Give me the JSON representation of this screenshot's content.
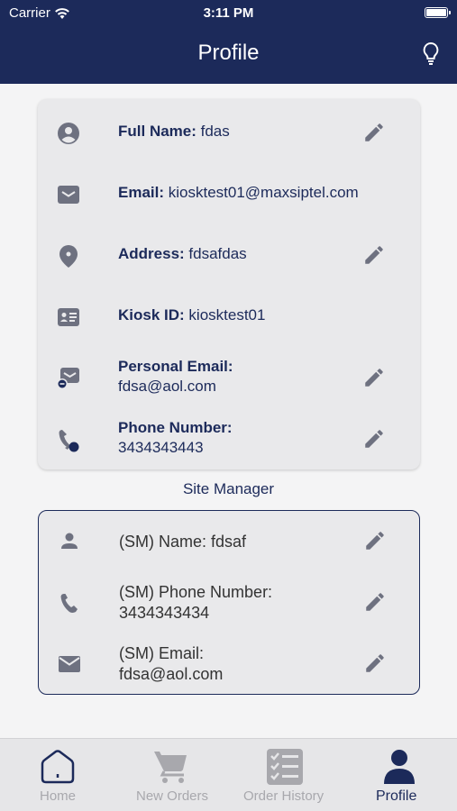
{
  "status_bar": {
    "carrier": "Carrier",
    "time": "3:11 PM"
  },
  "header": {
    "title": "Profile"
  },
  "profile": {
    "full_name": {
      "label": "Full Name:",
      "value": " fdas"
    },
    "email": {
      "label": "Email:",
      "value": " kiosktest01@maxsiptel.com"
    },
    "address": {
      "label": "Address:",
      "value": " fdsafdas"
    },
    "kiosk_id": {
      "label": "Kiosk ID:",
      "value": " kiosktest01"
    },
    "personal_email": {
      "label": "Personal Email:",
      "value": "fdsa@aol.com"
    },
    "phone": {
      "label": "Phone Number:",
      "value": "3434343443"
    }
  },
  "site_manager": {
    "title": "Site Manager",
    "name": {
      "label": "(SM) Name:",
      "value": " fdsaf"
    },
    "phone": {
      "label": "(SM) Phone Number:",
      "value": "3434343434"
    },
    "email": {
      "label": "(SM) Email:",
      "value": "fdsa@aol.com"
    }
  },
  "tabs": [
    {
      "label": "Home",
      "icon": "home-icon"
    },
    {
      "label": "New Orders",
      "icon": "cart-icon"
    },
    {
      "label": "Order History",
      "icon": "checklist-icon"
    },
    {
      "label": "Profile",
      "icon": "person-icon",
      "active": true
    }
  ],
  "colors": {
    "navy": "#1c2a5a",
    "icon_gray": "#6e7180",
    "inactive": "#a8a8ad"
  }
}
